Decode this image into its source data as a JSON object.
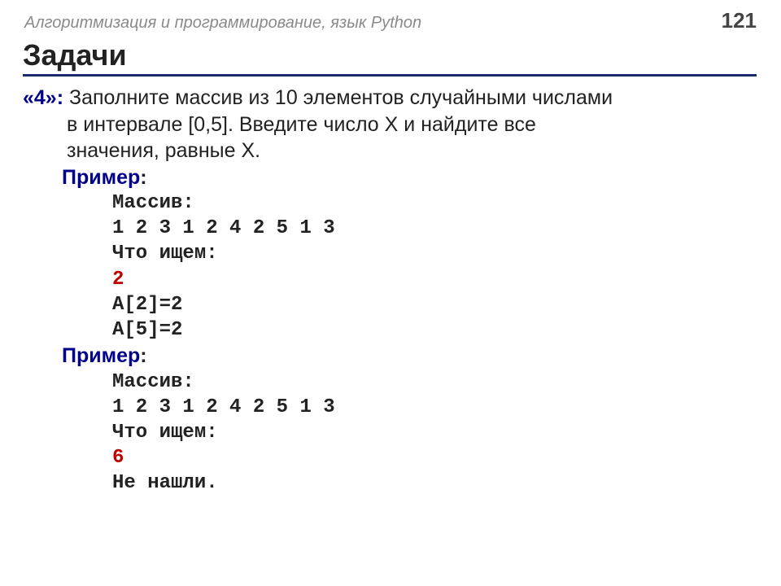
{
  "header": {
    "subject": "Алгоритмизация и программирование, язык Python",
    "page": "121"
  },
  "title": "Задачи",
  "task": {
    "label": "«4»:",
    "line1": "Заполните массив из 10 элементов случайными числами",
    "line2": "в интервале [0,5]. Введите число X и найдите все",
    "line3": "значения, равные X."
  },
  "example1": {
    "label": "Пример:",
    "l1": "Массив:",
    "l2": "1 2 3 1 2 4 2 5 1 3",
    "l3": "Что ищем:",
    "l4": "2",
    "l5": "A[2]=2",
    "l6": "A[5]=2"
  },
  "example2": {
    "label": "Пример:",
    "l1": "Массив:",
    "l2": "1 2 3 1 2 4 2 5 1 3",
    "l3": "Что ищем:",
    "l4": "6",
    "l5": "Не нашли."
  }
}
